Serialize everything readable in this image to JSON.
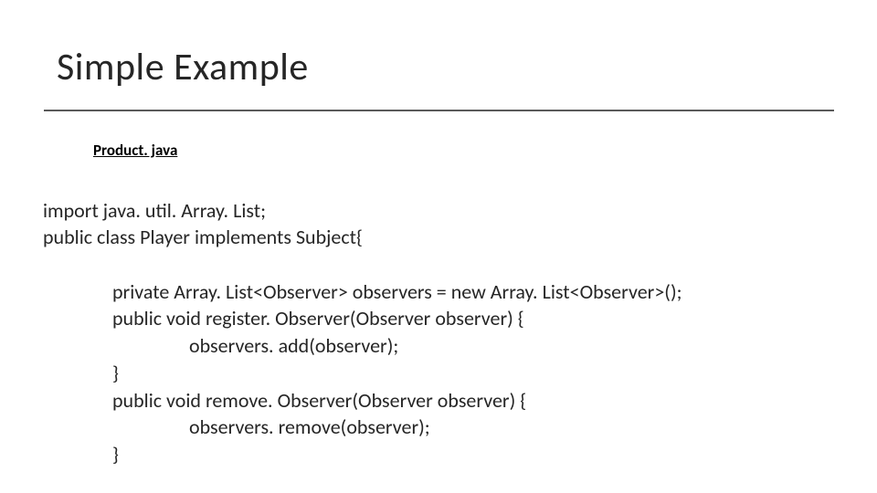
{
  "title": "Simple Example",
  "filename": "Product. java",
  "code": {
    "l1": "import java. util. Array. List;",
    "l2": "public class Player implements Subject{",
    "l3": "private Array. List<Observer> observers = new Array. List<Observer>();",
    "l4": "public void register. Observer(Observer observer) {",
    "l5": "observers. add(observer);",
    "l6": "}",
    "l7": "public void remove. Observer(Observer observer) {",
    "l8": "observers. remove(observer);",
    "l9": "}"
  }
}
